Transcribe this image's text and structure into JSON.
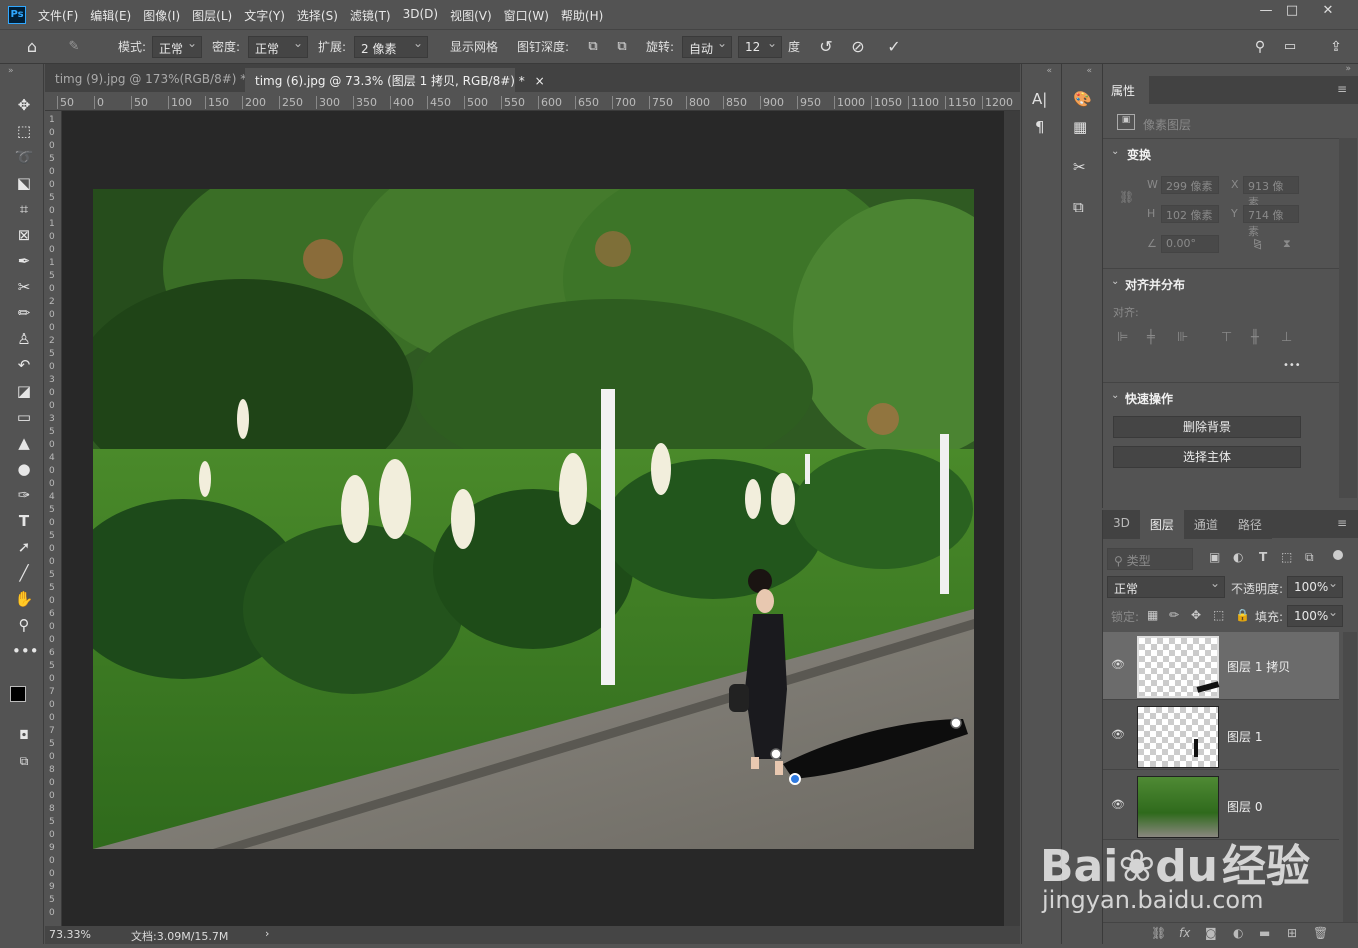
{
  "app": {
    "logo": "Ps"
  },
  "menu": [
    "文件(F)",
    "编辑(E)",
    "图像(I)",
    "图层(L)",
    "文字(Y)",
    "选择(S)",
    "滤镜(T)",
    "3D(D)",
    "视图(V)",
    "窗口(W)",
    "帮助(H)"
  ],
  "window_controls": {
    "minimize": "—",
    "maximize": "□",
    "close": "✕"
  },
  "options": {
    "mode_label": "模式:",
    "mode_value": "正常",
    "density_label": "密度:",
    "density_value": "正常",
    "expand_label": "扩展:",
    "expand_value": "2 像素",
    "show_mesh_label": "显示网格",
    "pin_depth_label": "图钉深度:",
    "rotate_label": "旋转:",
    "rotate_value": "自动",
    "rotate_deg": "12",
    "deg_unit": "度"
  },
  "tabs": [
    {
      "label": "timg (9).jpg @ 173%(RGB/8#) *",
      "close": "×"
    },
    {
      "label": "timg (6).jpg @ 73.3% (图层 1 拷贝, RGB/8#) *",
      "close": "×"
    }
  ],
  "ruler_h": [
    "50",
    "0",
    "50",
    "100",
    "150",
    "200",
    "250",
    "300",
    "350",
    "400",
    "450",
    "500",
    "550",
    "600",
    "650",
    "700",
    "750",
    "800",
    "850",
    "900",
    "950",
    "1000",
    "1050",
    "1100",
    "1150",
    "1200"
  ],
  "ruler_v": [
    "1",
    "0",
    "0",
    "5",
    "0",
    "0",
    "5",
    "0",
    "1",
    "0",
    "0",
    "1",
    "5",
    "0",
    "2",
    "0",
    "0",
    "2",
    "5",
    "0",
    "3",
    "0",
    "0",
    "3",
    "5",
    "0",
    "4",
    "0",
    "0",
    "4",
    "5",
    "0",
    "5",
    "0",
    "0",
    "5",
    "5",
    "0",
    "6",
    "0",
    "0",
    "6",
    "5",
    "0",
    "7",
    "0",
    "0",
    "7",
    "5",
    "0",
    "8",
    "0",
    "0",
    "8",
    "5",
    "0",
    "9",
    "0",
    "0",
    "9",
    "5",
    "0"
  ],
  "status": {
    "zoom": "73.33%",
    "doc": "文档:3.09M/15.7M",
    "arrow": "›"
  },
  "properties": {
    "tab": "属性",
    "pixel_layer": "像素图层",
    "transform_title": "变换",
    "w_label": "W",
    "w_value": "299 像素",
    "x_label": "X",
    "x_value": "913 像素",
    "h_label": "H",
    "h_value": "102 像素",
    "y_label": "Y",
    "y_value": "714 像素",
    "angle_value": "0.00°",
    "align_title": "对齐并分布",
    "align_label": "对齐:",
    "more": "•••",
    "quick_title": "快速操作",
    "remove_bg": "删除背景",
    "select_subject": "选择主体"
  },
  "layers_panel": {
    "tabs": [
      "3D",
      "图层",
      "通道",
      "路径"
    ],
    "active_tab": "图层",
    "filter_placeholder": "类型",
    "blend_mode": "正常",
    "opacity_label": "不透明度:",
    "opacity_value": "100%",
    "lock_label": "锁定:",
    "fill_label": "填充:",
    "fill_value": "100%",
    "layers": [
      {
        "name": "图层 1 拷贝",
        "selected": true
      },
      {
        "name": "图层 1",
        "selected": false
      },
      {
        "name": "图层 0",
        "selected": false
      }
    ]
  },
  "watermark": {
    "brand": "Bai",
    "brand2": "du",
    "cn": "经验",
    "url": "jingyan.baidu.com"
  }
}
